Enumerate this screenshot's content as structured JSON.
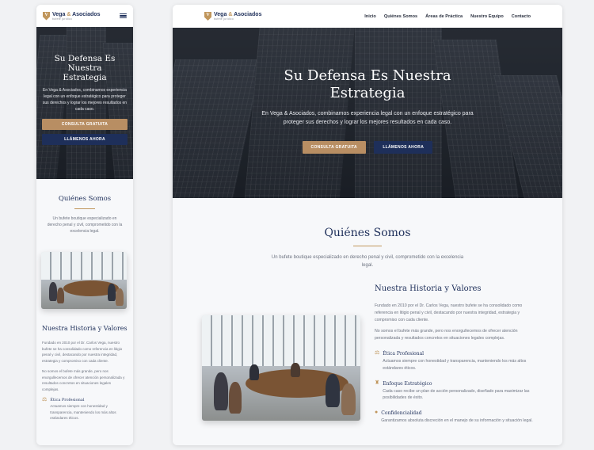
{
  "brand": {
    "name_part1": "Vega",
    "ampersand": "&",
    "name_part2": "Asociados",
    "tagline": "bufete jurídico",
    "shield_letter": "V"
  },
  "nav": {
    "links": [
      "Inicio",
      "Quiénes Somos",
      "Áreas de Práctica",
      "Nuestro Equipo",
      "Contacto"
    ]
  },
  "hero": {
    "title_line1": "Su Defensa Es Nuestra",
    "title_line2": "Estrategia",
    "subtitle_desktop": "En Vega & Asociados, combinamos experiencia legal con un enfoque estratégico para proteger sus derechos y lograr los mejores resultados en cada caso.",
    "subtitle_mobile": "En Vega & Asociados, combinamos experiencia legal con un enfoque estratégico para proteger sus derechos y lograr los mejores resultados en cada caso.",
    "cta_primary": "CONSULTA GRATUITA",
    "cta_secondary": "LLÁMENOS AHORA"
  },
  "about": {
    "title": "Quiénes Somos",
    "intro": "Un bufete boutique especializado en derecho penal y civil, comprometido con la excelencia legal.",
    "history_title": "Nuestra Historia y Valores",
    "history_p1": "Fundado en 2010 por el Dr. Carlos Vega, nuestro bufete se ha consolidado como referencia en litigio penal y civil, destacando por nuestra integridad, estrategia y compromiso con cada cliente.",
    "history_p2": "No somos el bufete más grande, pero nos enorgullecemos de ofrecer atención personalizada y resultados concretos en situaciones legales complejas.",
    "values": [
      {
        "icon": "scales-icon",
        "glyph": "⚖",
        "title": "Ética Profesional",
        "text": "Actuamos siempre con honestidad y transparencia, manteniendo los más altos estándares éticos."
      },
      {
        "icon": "chess-icon",
        "glyph": "♜",
        "title": "Enfoque Estratégico",
        "text": "Cada caso recibe un plan de acción personalizado, diseñado para maximizar las posibilidades de éxito."
      },
      {
        "icon": "user-lock-icon",
        "glyph": "●",
        "title": "Confidencialidad",
        "text": "Garantizamos absoluta discreción en el manejo de su información y situación legal."
      }
    ]
  },
  "colors": {
    "navy": "#1e2f5a",
    "gold": "#c0965c",
    "cta_gold": "#b88e63"
  }
}
